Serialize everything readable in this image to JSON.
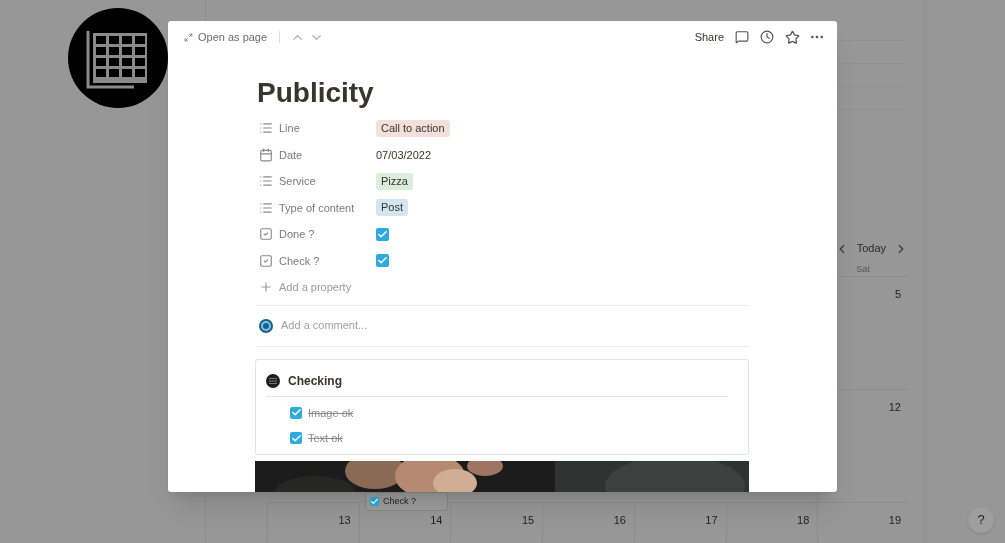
{
  "calendar": {
    "today": "Today",
    "weekday": "Sat",
    "sat_column": [
      "5",
      "12"
    ],
    "bottom_row": [
      "13",
      "14",
      "15",
      "16",
      "17",
      "18",
      "19"
    ],
    "card": {
      "label": "Check ?",
      "checked": true
    }
  },
  "modal": {
    "open_as_page": "Open as page",
    "share": "Share",
    "title": "Publicity",
    "properties": [
      {
        "kind": "select",
        "name": "Line",
        "value": "Call to action",
        "color": "#f4dfdb"
      },
      {
        "kind": "date",
        "name": "Date",
        "value": "07/03/2022"
      },
      {
        "kind": "select",
        "name": "Service",
        "value": "Pizza",
        "color": "#dbeddb"
      },
      {
        "kind": "select",
        "name": "Type of content",
        "value": "Post",
        "color": "#d3e5ef"
      },
      {
        "kind": "checkbox",
        "name": "Done ?",
        "checked": true
      },
      {
        "kind": "checkbox",
        "name": "Check ?",
        "checked": true
      }
    ],
    "add_property": "Add a property",
    "comment_placeholder": "Add a comment...",
    "callout": {
      "title": "Checking",
      "todos": [
        {
          "text": "Image ok",
          "checked": true
        },
        {
          "text": "Text ok",
          "checked": true
        }
      ]
    }
  },
  "help": "?"
}
